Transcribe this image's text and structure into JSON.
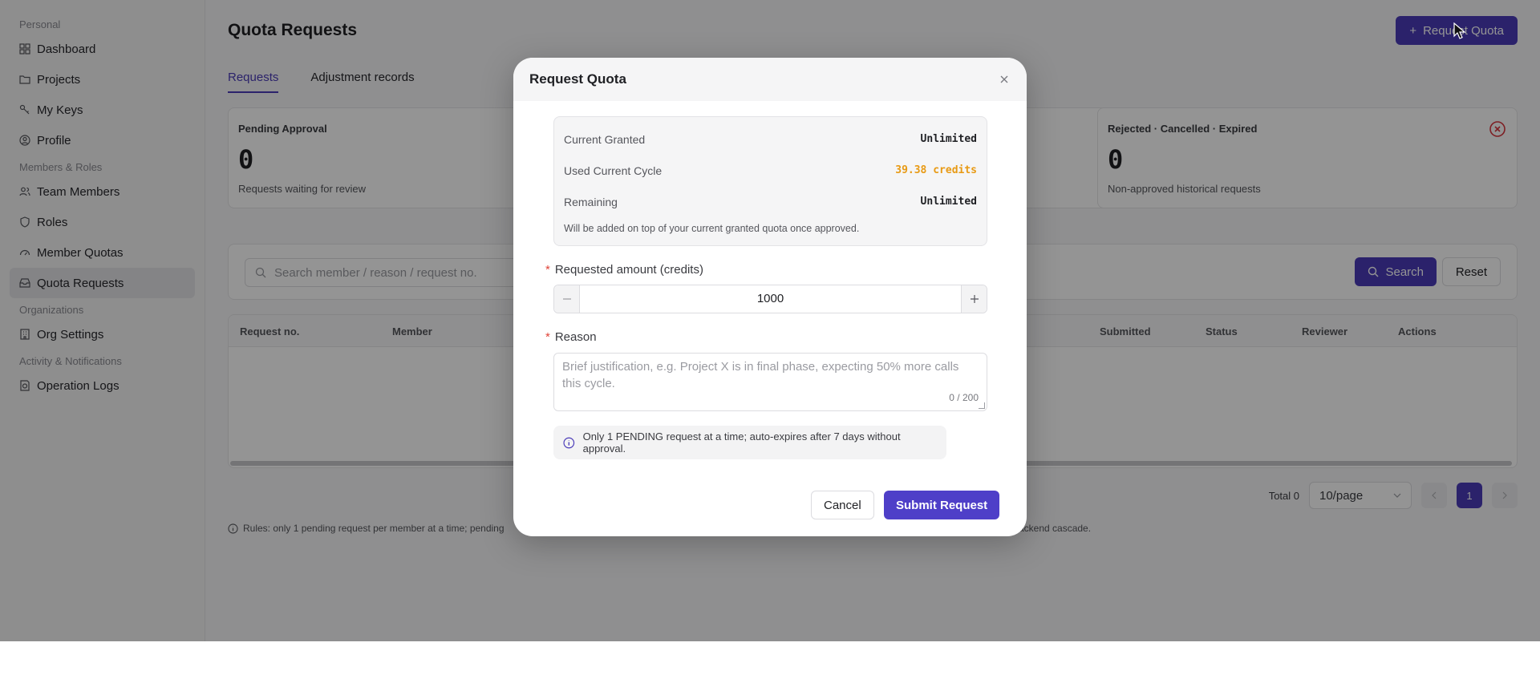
{
  "sidebar": {
    "sections": [
      {
        "title": "Personal",
        "items": [
          {
            "label": "Dashboard",
            "icon": "dashboard-icon"
          },
          {
            "label": "Projects",
            "icon": "folder-icon"
          },
          {
            "label": "My Keys",
            "icon": "key-icon"
          },
          {
            "label": "Profile",
            "icon": "user-circle-icon"
          }
        ]
      },
      {
        "title": "Members & Roles",
        "items": [
          {
            "label": "Team Members",
            "icon": "users-icon"
          },
          {
            "label": "Roles",
            "icon": "shield-icon"
          },
          {
            "label": "Member Quotas",
            "icon": "gauge-icon"
          },
          {
            "label": "Quota Requests",
            "icon": "inbox-icon",
            "active": true
          }
        ]
      },
      {
        "title": "Organizations",
        "items": [
          {
            "label": "Org Settings",
            "icon": "building-icon"
          }
        ]
      },
      {
        "title": "Activity & Notifications",
        "items": [
          {
            "label": "Operation Logs",
            "icon": "log-icon"
          }
        ]
      }
    ]
  },
  "page": {
    "title": "Quota Requests",
    "request_button": "Request Quota",
    "tabs": [
      "Requests",
      "Adjustment records"
    ],
    "stats": [
      {
        "label": "Pending Approval",
        "value": "0",
        "sub": "Requests waiting for review"
      },
      {
        "label": "Rejected · Cancelled · Expired",
        "value": "0",
        "sub": "Non-approved historical requests"
      }
    ],
    "search_placeholder": "Search member / reason / request no.",
    "search_button": "Search",
    "reset_button": "Reset",
    "columns": [
      "Request no.",
      "Member",
      "Submitted",
      "Status",
      "Reviewer",
      "Actions"
    ],
    "total": "Total 0",
    "page_size": "10/page",
    "current_page": "1",
    "rules_left": "Rules: only 1 pending request per member at a time; pending",
    "rules_right": "ackend cascade."
  },
  "modal": {
    "title": "Request Quota",
    "current_granted_label": "Current Granted",
    "current_granted_value": "Unlimited",
    "used_label": "Used Current Cycle",
    "used_value": "39.38 credits",
    "remaining_label": "Remaining",
    "remaining_value": "Unlimited",
    "note": "Will be added on top of your current granted quota once approved.",
    "amount_label": "Requested amount (credits)",
    "amount_value": "1000",
    "reason_label": "Reason",
    "reason_placeholder": "Brief justification, e.g. Project X is in final phase, expecting 50% more calls this cycle.",
    "reason_counter": "0 / 200",
    "notice": "Only 1 PENDING request at a time; auto-expires after 7 days without approval.",
    "cancel": "Cancel",
    "submit": "Submit Request"
  },
  "colors": {
    "accent": "#4a3bb8",
    "warning": "#e89a14",
    "success": "#2fa84f",
    "danger": "#d9363e"
  }
}
